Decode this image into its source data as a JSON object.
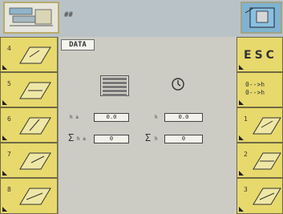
{
  "topbar": {
    "title": "##"
  },
  "main": {
    "tag": "DATA",
    "labels": {
      "h_a": "h a",
      "h": "h",
      "sum_h_a": "h a",
      "sum_h": "h"
    },
    "values": {
      "h_a": "0.0",
      "h": "0.0",
      "sum_h_a": "0",
      "sum_h": "0"
    }
  },
  "left_keys": [
    {
      "num": "4"
    },
    {
      "num": "5"
    },
    {
      "num": "6"
    },
    {
      "num": "7"
    },
    {
      "num": "8"
    }
  ],
  "right_keys": [
    {
      "label": "ESC"
    },
    {
      "line1": "0-->h",
      "line2": "0-->h"
    },
    {
      "num": "1"
    },
    {
      "num": "2"
    },
    {
      "num": "3"
    }
  ]
}
